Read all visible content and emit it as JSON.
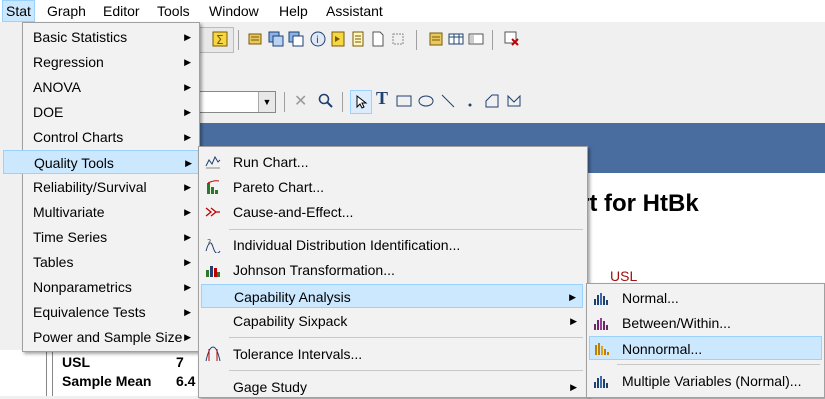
{
  "menubar": {
    "items": [
      {
        "label": "Stat",
        "u": "S"
      },
      {
        "label": "Graph",
        "u": "G"
      },
      {
        "label": "Editor",
        "u": "E"
      },
      {
        "label": "Tools",
        "u": "T"
      },
      {
        "label": "Window",
        "u": "W"
      },
      {
        "label": "Help",
        "u": "H"
      },
      {
        "label": "Assistant",
        "u": "n"
      }
    ]
  },
  "stat_menu": {
    "items": [
      {
        "label": "Basic Statistics",
        "submenu": true
      },
      {
        "label": "Regression",
        "submenu": true
      },
      {
        "label": "ANOVA",
        "submenu": true
      },
      {
        "label": "DOE",
        "submenu": true
      },
      {
        "label": "Control Charts",
        "submenu": true
      },
      {
        "label": "Quality Tools",
        "submenu": true,
        "highlighted": true
      },
      {
        "label": "Reliability/Survival",
        "submenu": true
      },
      {
        "label": "Multivariate",
        "submenu": true
      },
      {
        "label": "Time Series",
        "submenu": true
      },
      {
        "label": "Tables",
        "submenu": true
      },
      {
        "label": "Nonparametrics",
        "submenu": true
      },
      {
        "label": "Equivalence Tests",
        "submenu": true
      },
      {
        "label": "Power and Sample Size",
        "submenu": true
      }
    ]
  },
  "quality_menu": {
    "items": [
      {
        "label": "Run Chart...",
        "icon": "run-chart-icon"
      },
      {
        "label": "Pareto Chart...",
        "icon": "pareto-chart-icon"
      },
      {
        "label": "Cause-and-Effect...",
        "icon": "cause-effect-icon"
      },
      {
        "label": "Individual Distribution Identification...",
        "icon": "distribution-id-icon"
      },
      {
        "label": "Johnson Transformation...",
        "icon": "johnson-icon"
      },
      {
        "label": "Capability Analysis",
        "submenu": true,
        "highlighted": true
      },
      {
        "label": "Capability Sixpack",
        "submenu": true
      },
      {
        "label": "Tolerance Intervals...",
        "icon": "tolerance-icon"
      },
      {
        "label": "Gage Study",
        "submenu": true
      }
    ]
  },
  "capability_menu": {
    "items": [
      {
        "label": "Normal...",
        "icon": "histogram-icon"
      },
      {
        "label": "Between/Within...",
        "icon": "histogram-icon"
      },
      {
        "label": "Nonnormal...",
        "icon": "histogram-icon",
        "highlighted": true
      },
      {
        "label": "Multiple Variables (Normal)...",
        "icon": "histogram-icon"
      }
    ]
  },
  "document": {
    "title_fragment": "rt for HtBk",
    "usl_label": "USL",
    "stats": [
      {
        "label": "USL",
        "value": "7"
      },
      {
        "label": "Sample Mean",
        "value": "6.4"
      }
    ]
  },
  "colors": {
    "highlight": "#cce8ff",
    "highlight_border": "#99d1ff",
    "window_title_bar": "#4a6da0",
    "usl_red": "#a01010"
  }
}
